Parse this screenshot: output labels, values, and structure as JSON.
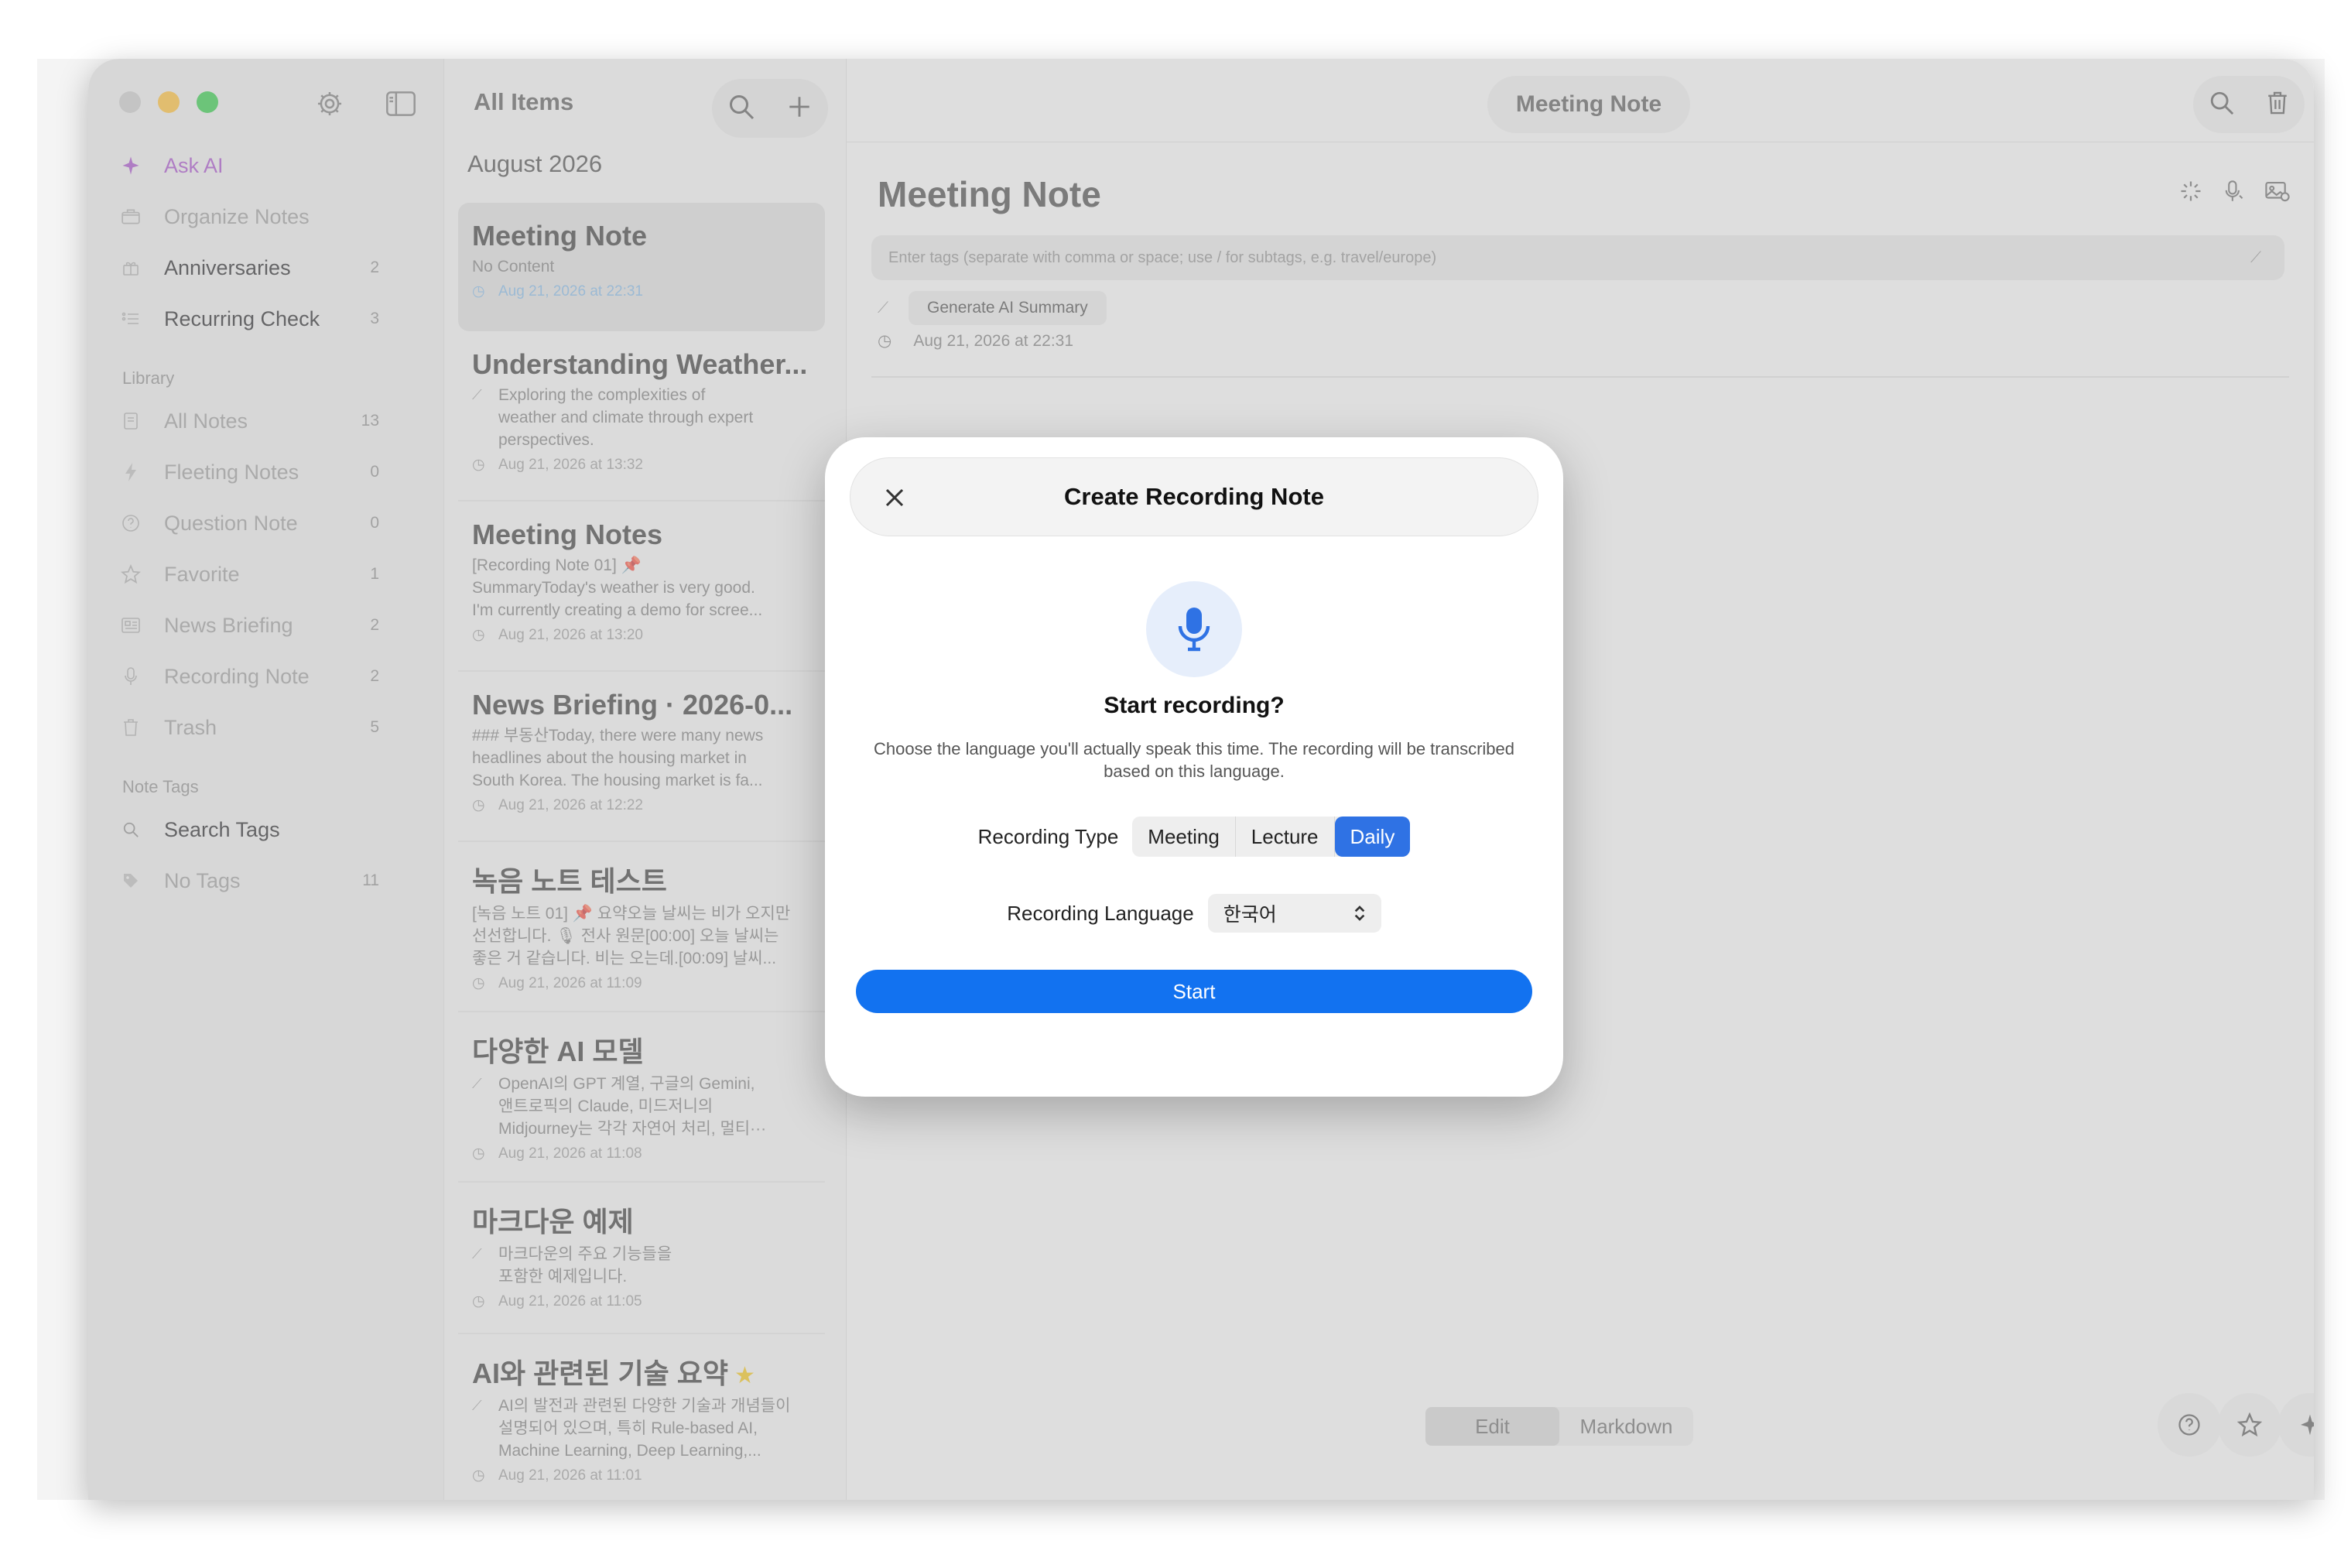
{
  "sidebar": {
    "items_top": [
      {
        "label": "Ask AI",
        "icon": "sparkle-icon",
        "color": "#a347c9"
      },
      {
        "label": "Organize Notes",
        "icon": "folder-tray-icon"
      },
      {
        "label": "Anniversaries",
        "icon": "gift-icon",
        "count": "2"
      },
      {
        "label": "Recurring Check",
        "icon": "checklist-icon",
        "count": "3"
      }
    ],
    "library_label": "Library",
    "library_items": [
      {
        "label": "All Notes",
        "icon": "note-icon",
        "count": "13"
      },
      {
        "label": "Fleeting Notes",
        "icon": "bolt-icon",
        "count": "0"
      },
      {
        "label": "Question Note",
        "icon": "question-icon",
        "count": "0"
      },
      {
        "label": "Favorite",
        "icon": "star-icon",
        "count": "1"
      },
      {
        "label": "News Briefing",
        "icon": "newspaper-icon",
        "count": "2"
      },
      {
        "label": "Recording Note",
        "icon": "mic-icon",
        "count": "2"
      },
      {
        "label": "Trash",
        "icon": "trash-icon",
        "count": "5"
      }
    ],
    "tags_label": "Note Tags",
    "tag_items": [
      {
        "label": "Search Tags",
        "icon": "search-icon"
      },
      {
        "label": "No Tags",
        "icon": "tag-off-icon",
        "count": "11"
      }
    ]
  },
  "list": {
    "title": "All Items",
    "month": "August 2026",
    "notes": [
      {
        "title": "Meeting Note",
        "preview": [
          "No Content"
        ],
        "date": "Aug 21, 2026 at 22:31",
        "selected": true
      },
      {
        "title": "Understanding Weather...",
        "preview": [
          "Exploring the complexities of",
          "weather and climate through expert",
          "perspectives."
        ],
        "date": "Aug 21, 2026 at 13:32",
        "wand": true
      },
      {
        "title": "Meeting Notes",
        "preview": [
          "[Recording Note 01] 📌",
          "SummaryToday's weather is very good.",
          "I'm currently creating a demo for scree..."
        ],
        "date": "Aug 21, 2026 at 13:20"
      },
      {
        "title": "News Briefing · 2026-0...",
        "preview": [
          "### 부동산Today, there were many news",
          "headlines about the housing market in",
          "South Korea. The housing market is fa..."
        ],
        "date": "Aug 21, 2026 at 12:22"
      },
      {
        "title": "녹음 노트 테스트",
        "preview": [
          "[녹음 노트 01] 📌 요약오늘 날씨는 비가 오지만",
          "선선합니다. 🎙 전사 원문[00:00] 오늘 날씨는",
          "좋은 거 같습니다. 비는 오는데.[00:09] 날씨..."
        ],
        "date": "Aug 21, 2026 at 11:09"
      },
      {
        "title": "다양한 AI 모델",
        "preview": [
          "OpenAI의 GPT 계열, 구글의 Gemini,",
          "앤트로픽의 Claude, 미드저니의",
          "Midjourney는 각각 자연어 처리, 멀티···"
        ],
        "date": "Aug 21, 2026 at 11:08",
        "wand": true
      },
      {
        "title": "마크다운 예제",
        "preview": [
          "마크다운의 주요 기능들을",
          "포함한 예제입니다."
        ],
        "date": "Aug 21, 2026 at 11:05",
        "wand": true
      },
      {
        "title": "AI와 관련된 기술 요약",
        "star": "★",
        "preview": [
          "AI의 발전과 관련된 다양한 기술과 개념들이",
          "설명되어 있으며, 특히 Rule-based AI,",
          "Machine Learning, Deep Learning,..."
        ],
        "date": "Aug 21, 2026 at 11:01",
        "wand": true
      }
    ]
  },
  "editor": {
    "header_title": "Meeting Note",
    "title": "Meeting Note",
    "tags_placeholder": "Enter tags (separate with comma or space; use / for subtags, e.g. travel/europe)",
    "generate_label": "Generate AI Summary",
    "date": "Aug 21, 2026 at 22:31",
    "mode_edit": "Edit",
    "mode_markdown": "Markdown"
  },
  "modal": {
    "title": "Create Recording Note",
    "heading": "Start recording?",
    "description": "Choose the language you'll actually speak this time. The recording will be transcribed based on this language.",
    "type_label": "Recording Type",
    "type_options": [
      "Meeting",
      "Lecture",
      "Daily"
    ],
    "type_selected": "Daily",
    "language_label": "Recording Language",
    "language_value": "한국어",
    "start_label": "Start"
  },
  "colors": {
    "accent": "#1272f0",
    "segment_active": "#2f72e4",
    "ask_ai": "#a347c9"
  }
}
